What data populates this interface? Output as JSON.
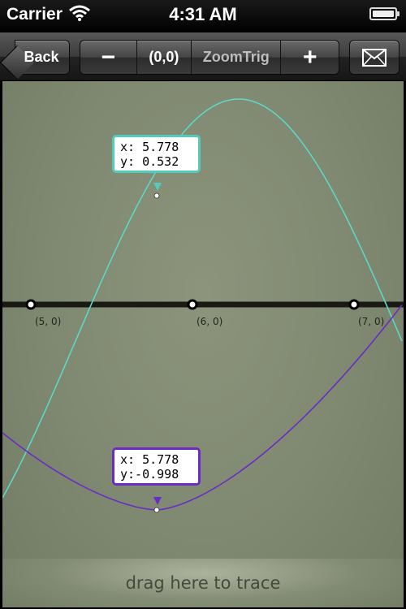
{
  "status_bar": {
    "carrier": "Carrier",
    "time": "4:31 AM"
  },
  "toolbar": {
    "back_label": "Back",
    "minus_label": "−",
    "origin_label": "(0,0)",
    "zoom_label": "ZoomTrig",
    "plus_label": "+",
    "mail_icon": "envelope-icon"
  },
  "graph": {
    "x_axis_labels": [
      "(5, 0)",
      "(6, 0)",
      "(7, 0)"
    ],
    "curves": [
      {
        "name": "cyan-curve",
        "color": "#5ed6c8"
      },
      {
        "name": "purple-curve",
        "color": "#6a2cc4"
      }
    ],
    "trace_cyan": {
      "x": "x: 5.778",
      "y": "y: 0.532"
    },
    "trace_purple": {
      "x": "x: 5.778",
      "y": "y:-0.998"
    }
  },
  "trace_hint": "drag here to trace"
}
